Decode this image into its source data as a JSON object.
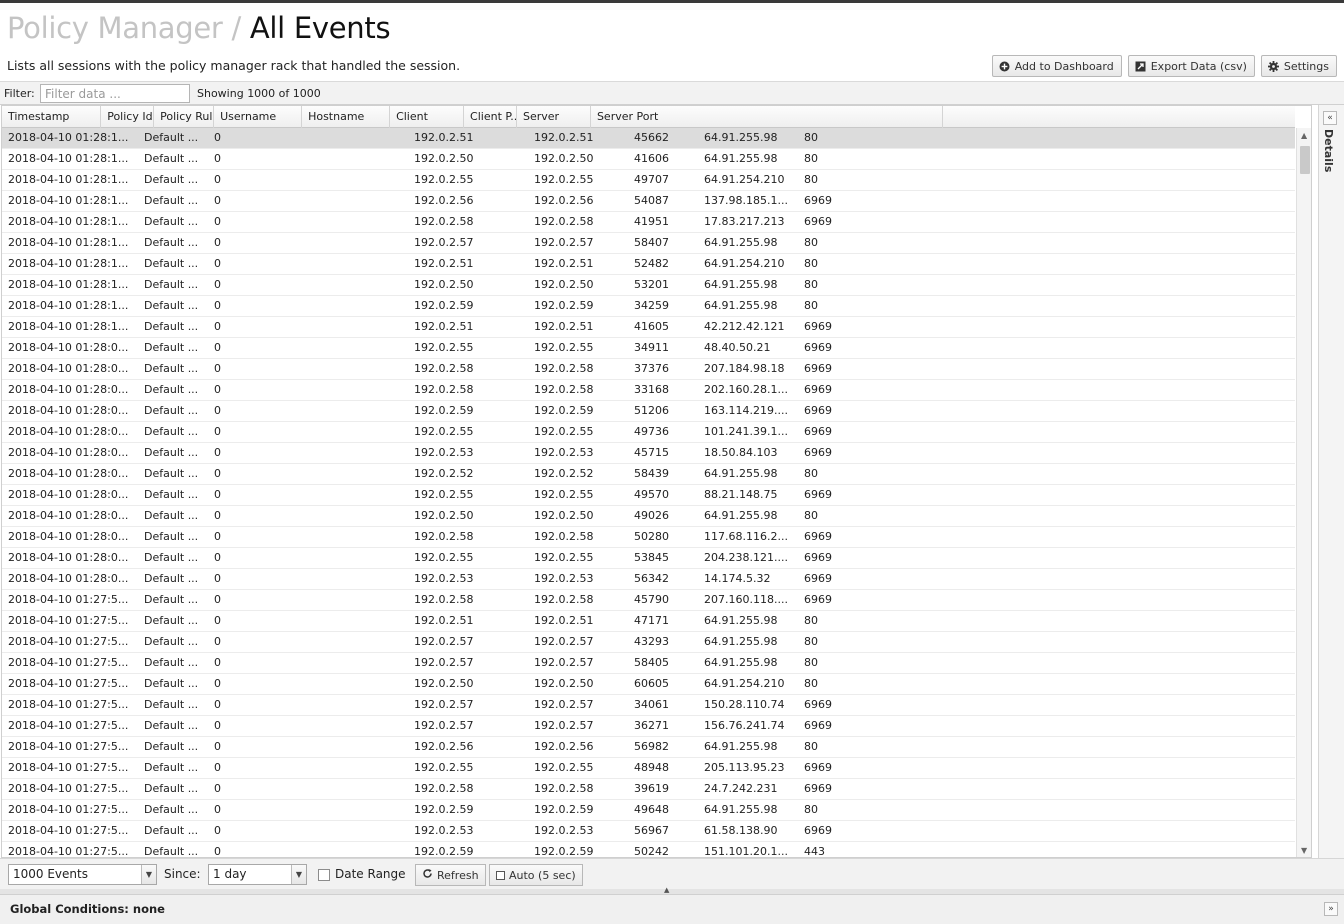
{
  "header": {
    "crumb": "Policy Manager",
    "separator": "/",
    "title": "All Events",
    "subtitle": "Lists all sessions with the policy manager rack that handled the session.",
    "buttons": {
      "add_dashboard": "Add to Dashboard",
      "export": "Export Data (csv)",
      "settings": "Settings"
    }
  },
  "filter": {
    "label": "Filter:",
    "placeholder": "Filter data ...",
    "count": "Showing 1000 of 1000"
  },
  "grid": {
    "columns": [
      "Timestamp",
      "Policy Id",
      "Policy Rule..",
      "Username",
      "Hostname",
      "Client",
      "Client P...",
      "Server",
      "Server Port"
    ],
    "rows": [
      [
        "2018-04-10 01:28:1...",
        "Default ...",
        "0",
        "",
        "192.0.2.51",
        "192.0.2.51",
        "45662",
        "64.91.255.98",
        "80"
      ],
      [
        "2018-04-10 01:28:1...",
        "Default ...",
        "0",
        "",
        "192.0.2.50",
        "192.0.2.50",
        "41606",
        "64.91.255.98",
        "80"
      ],
      [
        "2018-04-10 01:28:1...",
        "Default ...",
        "0",
        "",
        "192.0.2.55",
        "192.0.2.55",
        "49707",
        "64.91.254.210",
        "80"
      ],
      [
        "2018-04-10 01:28:1...",
        "Default ...",
        "0",
        "",
        "192.0.2.56",
        "192.0.2.56",
        "54087",
        "137.98.185.1...",
        "6969"
      ],
      [
        "2018-04-10 01:28:1...",
        "Default ...",
        "0",
        "",
        "192.0.2.58",
        "192.0.2.58",
        "41951",
        "17.83.217.213",
        "6969"
      ],
      [
        "2018-04-10 01:28:1...",
        "Default ...",
        "0",
        "",
        "192.0.2.57",
        "192.0.2.57",
        "58407",
        "64.91.255.98",
        "80"
      ],
      [
        "2018-04-10 01:28:1...",
        "Default ...",
        "0",
        "",
        "192.0.2.51",
        "192.0.2.51",
        "52482",
        "64.91.254.210",
        "80"
      ],
      [
        "2018-04-10 01:28:1...",
        "Default ...",
        "0",
        "",
        "192.0.2.50",
        "192.0.2.50",
        "53201",
        "64.91.255.98",
        "80"
      ],
      [
        "2018-04-10 01:28:1...",
        "Default ...",
        "0",
        "",
        "192.0.2.59",
        "192.0.2.59",
        "34259",
        "64.91.255.98",
        "80"
      ],
      [
        "2018-04-10 01:28:1...",
        "Default ...",
        "0",
        "",
        "192.0.2.51",
        "192.0.2.51",
        "41605",
        "42.212.42.121",
        "6969"
      ],
      [
        "2018-04-10 01:28:0...",
        "Default ...",
        "0",
        "",
        "192.0.2.55",
        "192.0.2.55",
        "34911",
        "48.40.50.21",
        "6969"
      ],
      [
        "2018-04-10 01:28:0...",
        "Default ...",
        "0",
        "",
        "192.0.2.58",
        "192.0.2.58",
        "37376",
        "207.184.98.18",
        "6969"
      ],
      [
        "2018-04-10 01:28:0...",
        "Default ...",
        "0",
        "",
        "192.0.2.58",
        "192.0.2.58",
        "33168",
        "202.160.28.1...",
        "6969"
      ],
      [
        "2018-04-10 01:28:0...",
        "Default ...",
        "0",
        "",
        "192.0.2.59",
        "192.0.2.59",
        "51206",
        "163.114.219....",
        "6969"
      ],
      [
        "2018-04-10 01:28:0...",
        "Default ...",
        "0",
        "",
        "192.0.2.55",
        "192.0.2.55",
        "49736",
        "101.241.39.1...",
        "6969"
      ],
      [
        "2018-04-10 01:28:0...",
        "Default ...",
        "0",
        "",
        "192.0.2.53",
        "192.0.2.53",
        "45715",
        "18.50.84.103",
        "6969"
      ],
      [
        "2018-04-10 01:28:0...",
        "Default ...",
        "0",
        "",
        "192.0.2.52",
        "192.0.2.52",
        "58439",
        "64.91.255.98",
        "80"
      ],
      [
        "2018-04-10 01:28:0...",
        "Default ...",
        "0",
        "",
        "192.0.2.55",
        "192.0.2.55",
        "49570",
        "88.21.148.75",
        "6969"
      ],
      [
        "2018-04-10 01:28:0...",
        "Default ...",
        "0",
        "",
        "192.0.2.50",
        "192.0.2.50",
        "49026",
        "64.91.255.98",
        "80"
      ],
      [
        "2018-04-10 01:28:0...",
        "Default ...",
        "0",
        "",
        "192.0.2.58",
        "192.0.2.58",
        "50280",
        "117.68.116.2...",
        "6969"
      ],
      [
        "2018-04-10 01:28:0...",
        "Default ...",
        "0",
        "",
        "192.0.2.55",
        "192.0.2.55",
        "53845",
        "204.238.121....",
        "6969"
      ],
      [
        "2018-04-10 01:28:0...",
        "Default ...",
        "0",
        "",
        "192.0.2.53",
        "192.0.2.53",
        "56342",
        "14.174.5.32",
        "6969"
      ],
      [
        "2018-04-10 01:27:5...",
        "Default ...",
        "0",
        "",
        "192.0.2.58",
        "192.0.2.58",
        "45790",
        "207.160.118....",
        "6969"
      ],
      [
        "2018-04-10 01:27:5...",
        "Default ...",
        "0",
        "",
        "192.0.2.51",
        "192.0.2.51",
        "47171",
        "64.91.255.98",
        "80"
      ],
      [
        "2018-04-10 01:27:5...",
        "Default ...",
        "0",
        "",
        "192.0.2.57",
        "192.0.2.57",
        "43293",
        "64.91.255.98",
        "80"
      ],
      [
        "2018-04-10 01:27:5...",
        "Default ...",
        "0",
        "",
        "192.0.2.57",
        "192.0.2.57",
        "58405",
        "64.91.255.98",
        "80"
      ],
      [
        "2018-04-10 01:27:5...",
        "Default ...",
        "0",
        "",
        "192.0.2.50",
        "192.0.2.50",
        "60605",
        "64.91.254.210",
        "80"
      ],
      [
        "2018-04-10 01:27:5...",
        "Default ...",
        "0",
        "",
        "192.0.2.57",
        "192.0.2.57",
        "34061",
        "150.28.110.74",
        "6969"
      ],
      [
        "2018-04-10 01:27:5...",
        "Default ...",
        "0",
        "",
        "192.0.2.57",
        "192.0.2.57",
        "36271",
        "156.76.241.74",
        "6969"
      ],
      [
        "2018-04-10 01:27:5...",
        "Default ...",
        "0",
        "",
        "192.0.2.56",
        "192.0.2.56",
        "56982",
        "64.91.255.98",
        "80"
      ],
      [
        "2018-04-10 01:27:5...",
        "Default ...",
        "0",
        "",
        "192.0.2.55",
        "192.0.2.55",
        "48948",
        "205.113.95.23",
        "6969"
      ],
      [
        "2018-04-10 01:27:5...",
        "Default ...",
        "0",
        "",
        "192.0.2.58",
        "192.0.2.58",
        "39619",
        "24.7.242.231",
        "6969"
      ],
      [
        "2018-04-10 01:27:5...",
        "Default ...",
        "0",
        "",
        "192.0.2.59",
        "192.0.2.59",
        "49648",
        "64.91.255.98",
        "80"
      ],
      [
        "2018-04-10 01:27:5...",
        "Default ...",
        "0",
        "",
        "192.0.2.53",
        "192.0.2.53",
        "56967",
        "61.58.138.90",
        "6969"
      ],
      [
        "2018-04-10 01:27:5...",
        "Default ...",
        "0",
        "",
        "192.0.2.59",
        "192.0.2.59",
        "50242",
        "151.101.20.1...",
        "443"
      ]
    ]
  },
  "details_panel": {
    "label": "Details"
  },
  "footer": {
    "events": "1000 Events",
    "since_label": "Since:",
    "since": "1 day",
    "date_range": "Date Range",
    "refresh": "Refresh",
    "auto": "Auto (5 sec)"
  },
  "global_conditions": "Global Conditions: none",
  "icons": {
    "add": "plus-circle-icon",
    "export": "export-icon",
    "settings": "gear-icon",
    "refresh": "refresh-icon",
    "collapse": "double-chevron-icon"
  }
}
